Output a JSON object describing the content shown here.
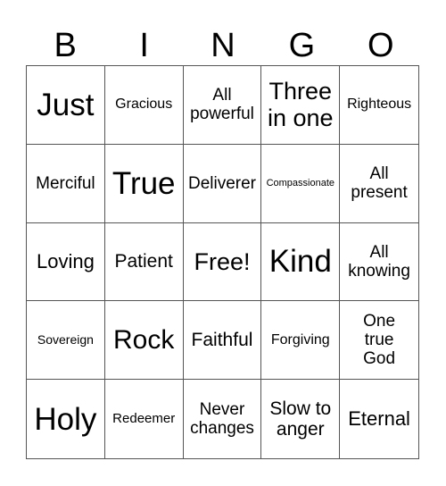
{
  "header": [
    "B",
    "I",
    "N",
    "G",
    "O"
  ],
  "cells": [
    "Just",
    "Gracious",
    "All powerful",
    "Three in one",
    "Righteous",
    "Merciful",
    "True",
    "Deliverer",
    "Compassionate",
    "All present",
    "Loving",
    "Patient",
    "Free!",
    "Kind",
    "All knowing",
    "Sovereign",
    "Rock",
    "Faithful",
    "Forgiving",
    "One true God",
    "Holy",
    "Redeemer",
    "Never changes",
    "Slow to anger",
    "Eternal"
  ]
}
